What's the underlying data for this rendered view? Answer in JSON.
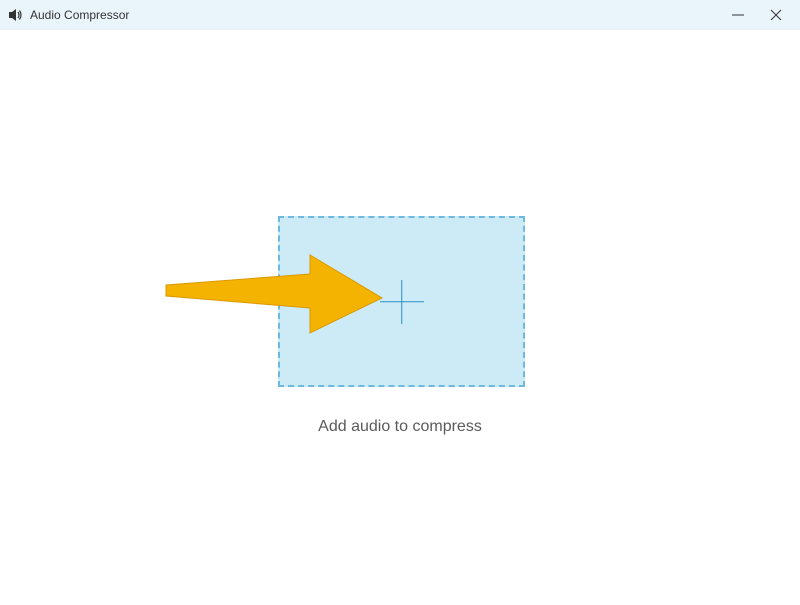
{
  "titlebar": {
    "app_title": "Audio Compressor"
  },
  "main": {
    "instruction": "Add audio to compress"
  },
  "icons": {
    "app": "speaker-icon",
    "minimize": "minimize-icon",
    "close": "close-icon",
    "plus": "plus-icon"
  }
}
